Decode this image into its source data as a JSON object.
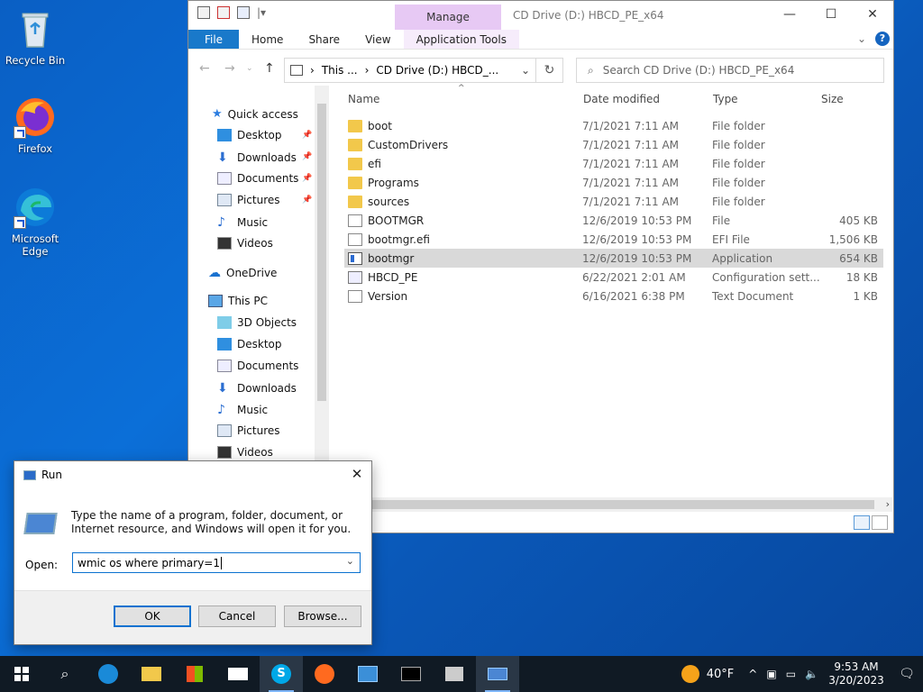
{
  "desktop": {
    "icons": [
      {
        "label": "Recycle Bin"
      },
      {
        "label": "Firefox"
      },
      {
        "label": "Microsoft Edge"
      }
    ]
  },
  "explorer": {
    "title": "CD Drive (D:) HBCD_PE_x64",
    "manage_tab": "Manage",
    "ribbon_tabs": [
      "File",
      "Home",
      "Share",
      "View",
      "Application Tools"
    ],
    "address_parts": [
      "This ...",
      "CD Drive (D:) HBCD_..."
    ],
    "search_placeholder": "Search CD Drive (D:) HBCD_PE_x64",
    "nav": {
      "quick_access": "Quick access",
      "quick_items": [
        "Desktop",
        "Downloads",
        "Documents",
        "Pictures",
        "Music",
        "Videos"
      ],
      "onedrive": "OneDrive",
      "this_pc": "This PC",
      "pc_items": [
        "3D Objects",
        "Desktop",
        "Documents",
        "Downloads",
        "Music",
        "Pictures",
        "Videos"
      ]
    },
    "columns": {
      "name": "Name",
      "date": "Date modified",
      "type": "Type",
      "size": "Size"
    },
    "files": [
      {
        "name": "boot",
        "date": "7/1/2021 7:11 AM",
        "type": "File folder",
        "size": "",
        "icon": "folder"
      },
      {
        "name": "CustomDrivers",
        "date": "7/1/2021 7:11 AM",
        "type": "File folder",
        "size": "",
        "icon": "folder"
      },
      {
        "name": "efi",
        "date": "7/1/2021 7:11 AM",
        "type": "File folder",
        "size": "",
        "icon": "folder"
      },
      {
        "name": "Programs",
        "date": "7/1/2021 7:11 AM",
        "type": "File folder",
        "size": "",
        "icon": "folder"
      },
      {
        "name": "sources",
        "date": "7/1/2021 7:11 AM",
        "type": "File folder",
        "size": "",
        "icon": "folder"
      },
      {
        "name": "BOOTMGR",
        "date": "12/6/2019 10:53 PM",
        "type": "File",
        "size": "405 KB",
        "icon": "file"
      },
      {
        "name": "bootmgr.efi",
        "date": "12/6/2019 10:53 PM",
        "type": "EFI File",
        "size": "1,506 KB",
        "icon": "file"
      },
      {
        "name": "bootmgr",
        "date": "12/6/2019 10:53 PM",
        "type": "Application",
        "size": "654 KB",
        "icon": "app",
        "selected": true
      },
      {
        "name": "HBCD_PE",
        "date": "6/22/2021 2:01 AM",
        "type": "Configuration sett...",
        "size": "18 KB",
        "icon": "config"
      },
      {
        "name": "Version",
        "date": "6/16/2021 6:38 PM",
        "type": "Text Document",
        "size": "1 KB",
        "icon": "file"
      }
    ]
  },
  "run_dialog": {
    "title": "Run",
    "description": "Type the name of a program, folder, document, or Internet resource, and Windows will open it for you.",
    "open_label": "Open:",
    "input_value": "wmic os where primary=1",
    "ok": "OK",
    "cancel": "Cancel",
    "browse": "Browse..."
  },
  "taskbar": {
    "weather": "40°F",
    "time": "9:53 AM",
    "date": "3/20/2023"
  }
}
